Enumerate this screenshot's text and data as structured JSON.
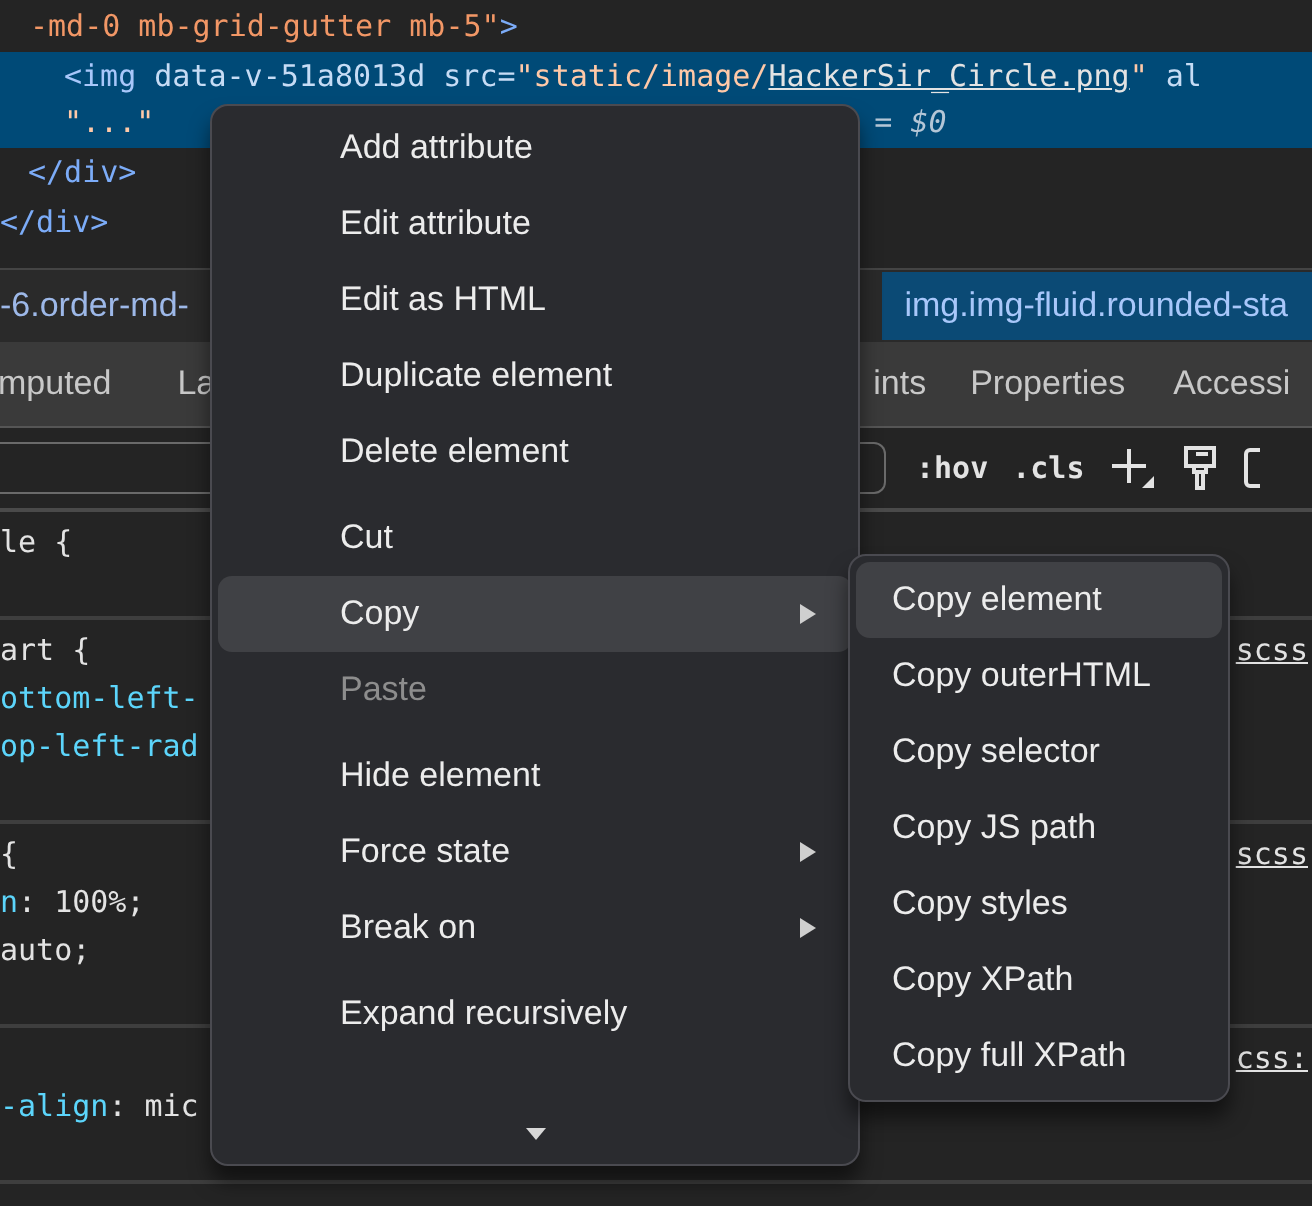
{
  "elements_panel": {
    "lines": [
      {
        "selected": false,
        "parts": [
          {
            "kind": "value",
            "text": "-md-0 mb-grid-gutter mb-5\""
          },
          {
            "kind": "tag",
            "text": ">"
          }
        ]
      },
      {
        "selected": true,
        "parts": [
          {
            "kind": "tag",
            "text": "<img"
          },
          {
            "kind": "attr",
            "text": " data-v-51a8013d"
          },
          {
            "kind": "attr",
            "text": " src="
          },
          {
            "kind": "value",
            "text": "\"static/image/"
          },
          {
            "kind": "link",
            "text": "HackerSir_Circle.png"
          },
          {
            "kind": "value",
            "text": "\""
          },
          {
            "kind": "attr",
            "text": " al"
          }
        ]
      },
      {
        "selected": true,
        "parts": [
          {
            "kind": "value",
            "text": "\"...\""
          }
        ],
        "tail": "= $0"
      },
      {
        "selected": false,
        "parts": [
          {
            "kind": "tag",
            "text": "</div>"
          }
        ]
      },
      {
        "selected": false,
        "parts": [
          {
            "kind": "tag",
            "text": "</div>"
          }
        ]
      }
    ]
  },
  "breadcrumbs": [
    {
      "label": "-6.order-md-",
      "selected": false
    },
    {
      "label": "img.img-fluid.rounded-sta",
      "selected": true
    }
  ],
  "tabs": [
    {
      "label": "mputed"
    },
    {
      "label": "La"
    },
    {
      "label": "ints"
    },
    {
      "label": "Properties"
    },
    {
      "label": "Accessi"
    }
  ],
  "filter_bar": {
    "hov": ":hov",
    "cls": ".cls"
  },
  "style_rules": [
    {
      "lines": [
        {
          "parts": [
            {
              "kind": "plain",
              "text": "le {"
            }
          ]
        }
      ]
    },
    {
      "lines": [
        {
          "parts": [
            {
              "kind": "plain",
              "text": "art {"
            }
          ],
          "source": "scss"
        },
        {
          "parts": [
            {
              "kind": "prop",
              "text": "ottom-left-"
            }
          ]
        },
        {
          "parts": [
            {
              "kind": "prop",
              "text": "op-left-rad"
            }
          ]
        }
      ]
    },
    {
      "lines": [
        {
          "parts": [
            {
              "kind": "plain",
              "text": "{"
            }
          ],
          "source": "scss"
        },
        {
          "parts": [
            {
              "kind": "prop",
              "text": "n"
            },
            {
              "kind": "plain",
              "text": ": 100%;"
            }
          ]
        },
        {
          "parts": [
            {
              "kind": "plain",
              "text": "auto;"
            }
          ]
        }
      ]
    },
    {
      "lines": [
        {
          "source": "css:"
        },
        {
          "parts": [
            {
              "kind": "prop",
              "text": "-align"
            },
            {
              "kind": "plain",
              "text": ": mic"
            }
          ]
        }
      ]
    }
  ],
  "context_menu": {
    "groups": [
      [
        {
          "label": "Add attribute",
          "selected": false,
          "disabled": false,
          "submenu": false
        },
        {
          "label": "Edit attribute",
          "selected": false,
          "disabled": false,
          "submenu": false
        },
        {
          "label": "Edit as HTML",
          "selected": false,
          "disabled": false,
          "submenu": false
        },
        {
          "label": "Duplicate element",
          "selected": false,
          "disabled": false,
          "submenu": false
        },
        {
          "label": "Delete element",
          "selected": false,
          "disabled": false,
          "submenu": false
        }
      ],
      [
        {
          "label": "Cut",
          "selected": false,
          "disabled": false,
          "submenu": false
        },
        {
          "label": "Copy",
          "selected": true,
          "disabled": false,
          "submenu": true
        },
        {
          "label": "Paste",
          "selected": false,
          "disabled": true,
          "submenu": false
        }
      ],
      [
        {
          "label": "Hide element",
          "selected": false,
          "disabled": false,
          "submenu": false
        },
        {
          "label": "Force state",
          "selected": false,
          "disabled": false,
          "submenu": true
        },
        {
          "label": "Break on",
          "selected": false,
          "disabled": false,
          "submenu": true
        }
      ],
      [
        {
          "label": "Expand recursively",
          "selected": false,
          "disabled": false,
          "submenu": false
        }
      ]
    ]
  },
  "submenu": {
    "items": [
      {
        "label": "Copy element",
        "selected": true
      },
      {
        "label": "Copy outerHTML",
        "selected": false
      },
      {
        "label": "Copy selector",
        "selected": false
      },
      {
        "label": "Copy JS path",
        "selected": false
      },
      {
        "label": "Copy styles",
        "selected": false
      },
      {
        "label": "Copy XPath",
        "selected": false
      },
      {
        "label": "Copy full XPath",
        "selected": false
      }
    ]
  }
}
